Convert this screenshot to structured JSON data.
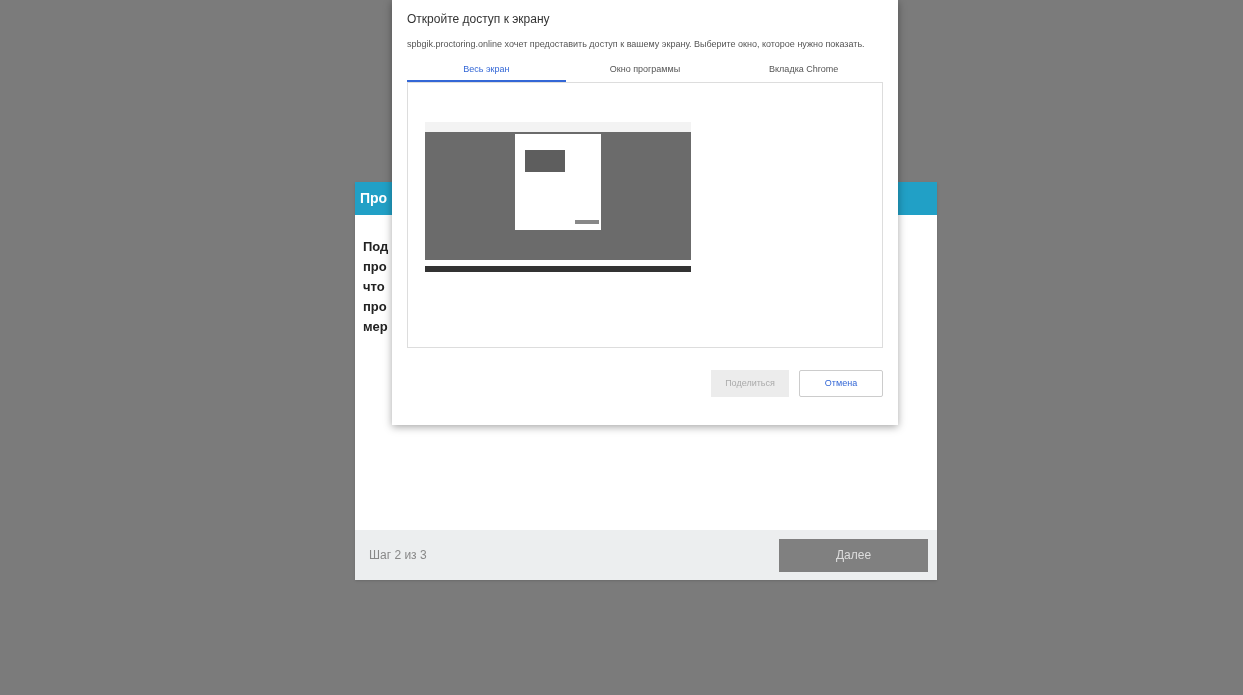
{
  "step_modal": {
    "title": "Про",
    "body_lines": [
      "Под",
      "про",
      "что",
      "про",
      "мер"
    ],
    "step": "Шаг 2 из 3",
    "next_button": {
      "label": "Далее",
      "disabled": true
    }
  },
  "share_dialog": {
    "title": "Откройте доступ к экрану",
    "message": "spbgik.proctoring.online хочет предоставить доступ к вашему экрану. Выберите окно, которое нужно показать.",
    "tabs": [
      {
        "label": "Весь экран",
        "selected": true
      },
      {
        "label": "Окно программы",
        "selected": false
      },
      {
        "label": "Вкладка Chrome",
        "selected": false
      }
    ],
    "share_button": {
      "label": "Поделиться",
      "disabled": true
    },
    "cancel_button": {
      "label": "Отмена"
    }
  }
}
